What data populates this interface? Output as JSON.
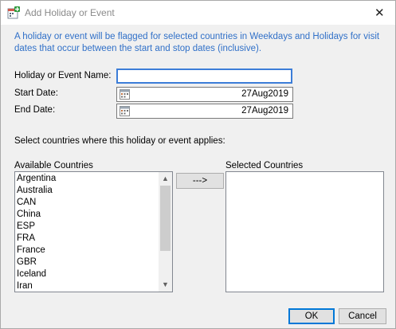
{
  "window": {
    "title": "Add Holiday or Event"
  },
  "info_text": "A holiday or event will be flagged for selected countries in Weekdays and Holidays for visit dates that occur between the start and stop dates (inclusive).",
  "form": {
    "name_label": "Holiday or Event Name:",
    "name_value": "",
    "start_label": "Start Date:",
    "start_value": "27Aug2019",
    "end_label": "End Date:",
    "end_value": "27Aug2019"
  },
  "countries_prompt": "Select countries where this holiday or event applies:",
  "available": {
    "label": "Available Countries",
    "items": [
      "Argentina",
      "Australia",
      "CAN",
      "China",
      "ESP",
      "FRA",
      "France",
      "GBR",
      "Iceland",
      "Iran"
    ]
  },
  "selected": {
    "label": "Selected Countries",
    "items": []
  },
  "buttons": {
    "move": "--->",
    "ok": "OK",
    "cancel": "Cancel"
  },
  "icons": {
    "app": "add-calendar-icon",
    "close": "close-icon",
    "calendar": "calendar-icon"
  }
}
